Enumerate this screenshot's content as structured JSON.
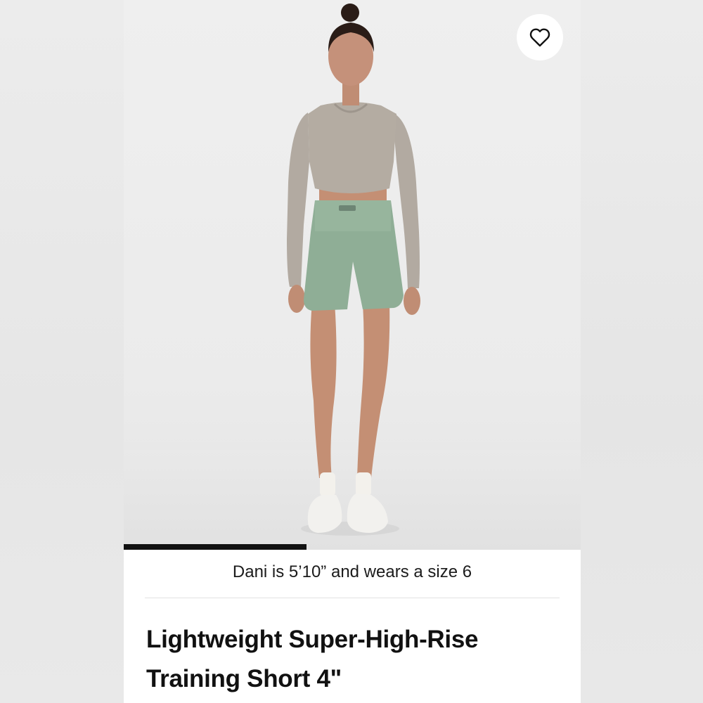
{
  "product": {
    "title": "Lightweight Super-High-Rise Training Short 4\"",
    "model_note": "Dani is 5’10” and wears a size 6"
  },
  "gallery": {
    "progress_fraction": 0.4,
    "favorite_icon": "heart-outline-icon",
    "garment_colors": {
      "top": "#b4aca2",
      "shorts": "#8fae96",
      "background": "#ececec"
    }
  }
}
